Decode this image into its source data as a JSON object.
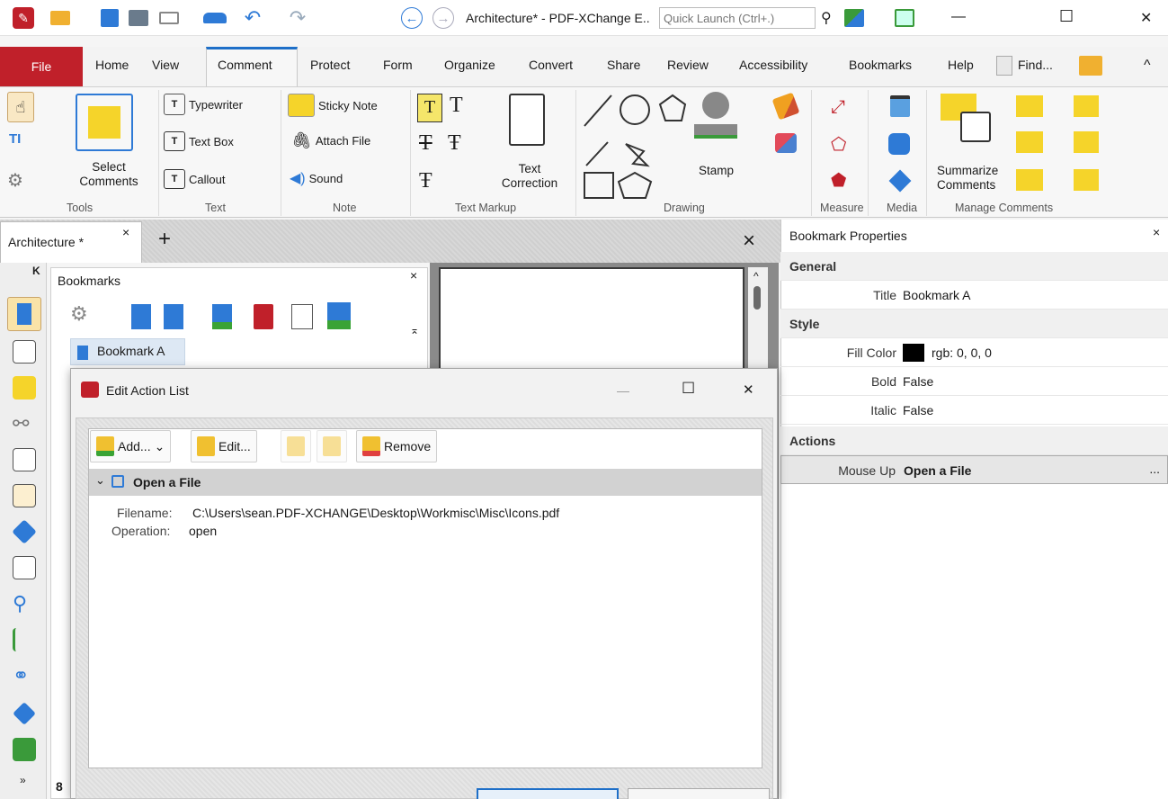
{
  "window": {
    "title": "Architecture* - PDF-XChange E..",
    "search_placeholder": "Quick Launch (Ctrl+.)",
    "minimize": "—",
    "maximize": "☐",
    "close": "✕"
  },
  "menu": {
    "file": "File",
    "items": [
      "Home",
      "View",
      "Comment",
      "Protect",
      "Form",
      "Organize",
      "Convert",
      "Share",
      "Review",
      "Accessibility",
      "Bookmarks",
      "Help"
    ],
    "find": "Find...",
    "collapse": "^"
  },
  "ribbon": {
    "tools": {
      "select": "Select\nComments",
      "label": "Tools"
    },
    "text": {
      "typewriter": "Typewriter",
      "textbox": "Text Box",
      "callout": "Callout",
      "label": "Text"
    },
    "note": {
      "sticky": "Sticky Note",
      "attach": "Attach File",
      "sound": "Sound",
      "label": "Note"
    },
    "markup": {
      "correction": "Text\nCorrection",
      "label": "Text Markup"
    },
    "drawing": {
      "stamp": "Stamp",
      "label": "Drawing"
    },
    "measure": {
      "label": "Measure"
    },
    "media": {
      "label": "Media"
    },
    "manage": {
      "summarize": "Summarize\nComments",
      "label": "Manage Comments"
    }
  },
  "doc_tab": {
    "title": "Architecture *",
    "close": "×",
    "add": "+",
    "close_all": "×"
  },
  "bookmarks": {
    "title": "Bookmarks",
    "close": "×",
    "item": "Bookmark A",
    "page_num": "8"
  },
  "props": {
    "title": "Bookmark Properties",
    "close": "×",
    "general": "General",
    "title_label": "Title",
    "title_value": "Bookmark A",
    "style": "Style",
    "fill_label": "Fill Color",
    "fill_value": "rgb: 0, 0, 0",
    "bold_label": "Bold",
    "bold_value": "False",
    "italic_label": "Italic",
    "italic_value": "False",
    "actions": "Actions",
    "mouseup_label": "Mouse Up",
    "mouseup_value": "Open a File",
    "more": "..."
  },
  "dialog": {
    "title": "Edit Action List",
    "add": "Add...",
    "edit": "Edit...",
    "remove": "Remove",
    "action": "Open a File",
    "filename_label": "Filename:",
    "filename": "C:\\Users\\sean.PDF-XCHANGE\\Desktop\\Workmisc\\Misc\\Icons.pdf",
    "operation_label": "Operation:",
    "operation": "open",
    "minimize": "—",
    "maximize": "☐",
    "close": "✕"
  },
  "colors": {
    "accent": "#1e6fc8",
    "file_menu": "#c0202a",
    "green": "#3aa335",
    "orange": "#f0a020"
  }
}
